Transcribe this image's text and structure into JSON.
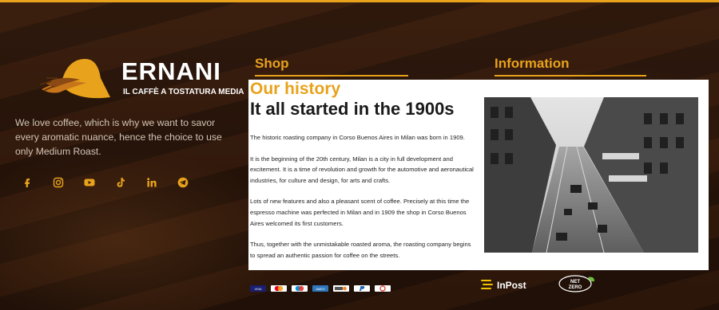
{
  "brand": {
    "name": "ERNANI",
    "tagline": "IL CAFFÈ A TOSTATURA MEDIA",
    "about": "We love coffee, which is why we want to savor every aromatic nuance, hence the choice to use only Medium Roast."
  },
  "socials": [
    {
      "icon": "facebook-icon"
    },
    {
      "icon": "instagram-icon"
    },
    {
      "icon": "youtube-icon"
    },
    {
      "icon": "tiktok-icon"
    },
    {
      "icon": "linkedin-icon"
    },
    {
      "icon": "telegram-icon"
    }
  ],
  "columns": {
    "shop": "Shop",
    "information": "Information"
  },
  "popup": {
    "kicker": "Our history",
    "title": "It all started in the 1900s",
    "paragraphs": [
      "The historic roasting company in Corso Buenos Aires in Milan was born in 1909.",
      "It is the beginning of the 20th century, Milan is a city in full development and excitement. It is a time of revolution and growth for the automotive and aeronautical industries, for culture and design, for arts and crafts.",
      "Lots of new features and also a pleasant scent of coffee. Precisely at this time the espresso machine was perfected in Milan and in 1909 the shop in Corso Buenos Aires welcomed its first customers.",
      "Thus, together with the unmistakable roasted aroma, the roasting company begins to spread an authentic passion for coffee on the streets."
    ],
    "photo_icon": "historic-street-photo"
  },
  "payments": [
    {
      "name": "visa-icon",
      "label": "VISA",
      "color": "#1a1f71"
    },
    {
      "name": "mastercard-icon",
      "label": "",
      "color": "#eb5a2a"
    },
    {
      "name": "maestro-icon",
      "label": "",
      "color": "#2f6fd6"
    },
    {
      "name": "amex-icon",
      "label": "AMEX",
      "color": "#2e77bb"
    },
    {
      "name": "discover-icon",
      "label": "",
      "color": "#555555"
    },
    {
      "name": "paypal-icon",
      "label": "",
      "color": "#1f62b5"
    },
    {
      "name": "gpay-icon",
      "label": "",
      "color": "#e04a3b"
    }
  ],
  "partners": {
    "inpost": "InPost",
    "netzero_top": "NET",
    "netzero_bottom": "ZERO"
  },
  "colors": {
    "accent": "#e8a21b",
    "background": "#2a160c"
  }
}
